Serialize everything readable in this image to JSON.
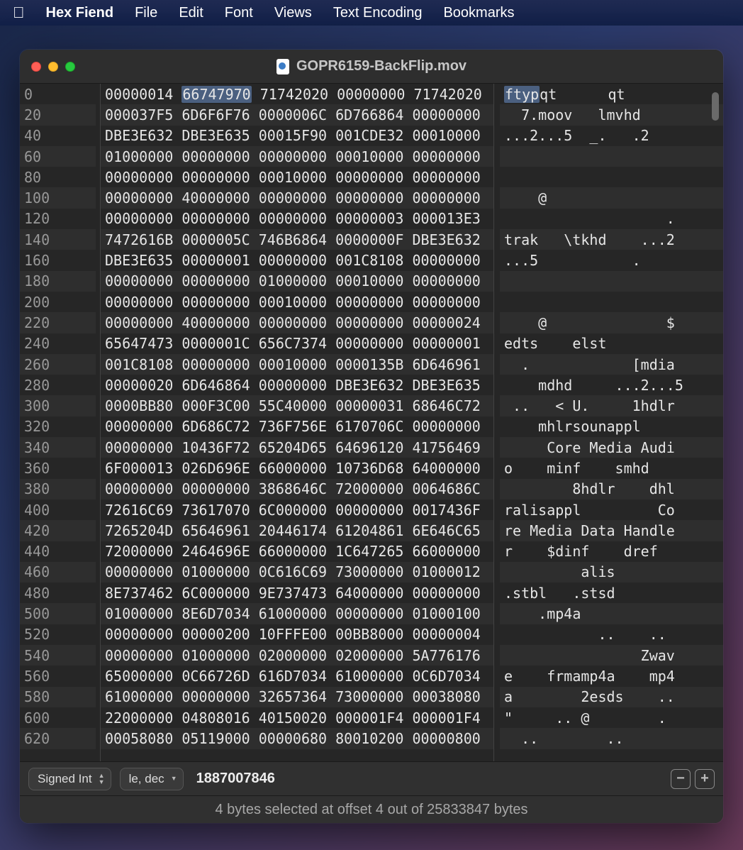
{
  "menubar": {
    "app": "Hex Fiend",
    "items": [
      "File",
      "Edit",
      "Font",
      "Views",
      "Text Encoding",
      "Bookmarks"
    ]
  },
  "window": {
    "title": "GOPR6159-BackFlip.mov"
  },
  "hex": {
    "offsets": [
      "0",
      "20",
      "40",
      "60",
      "80",
      "100",
      "120",
      "140",
      "160",
      "180",
      "200",
      "220",
      "240",
      "260",
      "280",
      "300",
      "320",
      "340",
      "360",
      "380",
      "400",
      "420",
      "440",
      "460",
      "480",
      "500",
      "520",
      "540",
      "560",
      "580",
      "600",
      "620"
    ],
    "rows": [
      "00000014 66747970 71742020 00000000 71742020",
      "000037F5 6D6F6F76 0000006C 6D766864 00000000",
      "DBE3E632 DBE3E635 00015F90 001CDE32 00010000",
      "01000000 00000000 00000000 00010000 00000000",
      "00000000 00000000 00010000 00000000 00000000",
      "00000000 40000000 00000000 00000000 00000000",
      "00000000 00000000 00000000 00000003 000013E3",
      "7472616B 0000005C 746B6864 0000000F DBE3E632",
      "DBE3E635 00000001 00000000 001C8108 00000000",
      "00000000 00000000 01000000 00010000 00000000",
      "00000000 00000000 00010000 00000000 00000000",
      "00000000 40000000 00000000 00000000 00000024",
      "65647473 0000001C 656C7374 00000000 00000001",
      "001C8108 00000000 00010000 0000135B 6D646961",
      "00000020 6D646864 00000000 DBE3E632 DBE3E635",
      "0000BB80 000F3C00 55C40000 00000031 68646C72",
      "00000000 6D686C72 736F756E 6170706C 00000000",
      "00000000 10436F72 65204D65 64696120 41756469",
      "6F000013 026D696E 66000000 10736D68 64000000",
      "00000000 00000000 3868646C 72000000 0064686C",
      "72616C69 73617070 6C000000 00000000 0017436F",
      "7265204D 65646961 20446174 61204861 6E646C65",
      "72000000 2464696E 66000000 1C647265 66000000",
      "00000000 01000000 0C616C69 73000000 01000012",
      "8E737462 6C000000 9E737473 64000000 00000000",
      "01000000 8E6D7034 61000000 00000000 01000100",
      "00000000 00000200 10FFFE00 00BB8000 00000004",
      "00000000 01000000 02000000 02000000 5A776176",
      "65000000 0C66726D 616D7034 61000000 0C6D7034",
      "61000000 00000000 32657364 73000000 00038080",
      "22000000 04808016 40150020 000001F4 000001F4",
      "00058080 05119000 00000680 80010200 00000800"
    ],
    "ascii": [
      "    ftypqt      qt  ",
      "  7.moov   lmvhd    ",
      "...2...5  _.   .2   ",
      "                    ",
      "                    ",
      "    @               ",
      "                   .",
      "trak   \\tkhd    ...2",
      "...5           .    ",
      "                    ",
      "                    ",
      "    @              $",
      "edts    elst        ",
      "  .            [mdia",
      "    mdhd     ...2...5",
      " ..   < U.     1hdlr",
      "    mhlrsounappl    ",
      "     Core Media Audi",
      "o    minf    smhd   ",
      "        8hdlr    dhl",
      "ralisappl         Co",
      "re Media Data Handle",
      "r    $dinf    dref  ",
      "         alis       ",
      ".stbl   .stsd       ",
      "    .mp4a           ",
      "           ..    .. ",
      "                Zwav",
      "e    frmamp4a    mp4",
      "a        2esds    ..",
      "\"     .. @        . ",
      "  ..        ..      "
    ],
    "selected_col": 1,
    "selected_row": 0,
    "ascii_sel": "ftyp"
  },
  "inspector": {
    "type": "Signed Int",
    "format": "le, dec",
    "value": "1887007846"
  },
  "status": "4 bytes selected at offset 4 out of 25833847 bytes"
}
